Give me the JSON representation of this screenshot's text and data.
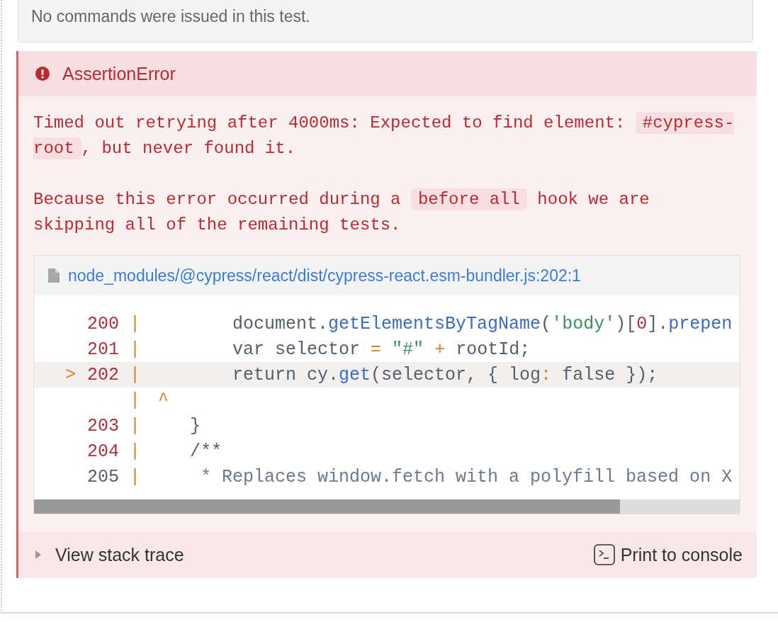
{
  "commands_notice": "No commands were issued in this test.",
  "error": {
    "title": "AssertionError",
    "messages": [
      [
        {
          "text": "Timed out retrying after 4000ms: Expected to find element: ",
          "code": false
        },
        {
          "text": "#cypress-root",
          "code": true
        },
        {
          "text": ", but never found it.",
          "code": false
        }
      ],
      [
        {
          "text": "Because this error occurred during a ",
          "code": false
        },
        {
          "text": "before all",
          "code": true
        },
        {
          "text": " hook we are skipping all of the remaining tests.",
          "code": false
        }
      ]
    ],
    "code_frame": {
      "file": "node_modules/@cypress/react/dist/cypress-react.esm-bundler.js:202:1",
      "lines": [
        {
          "gutter": "200 |",
          "highlighted": false,
          "code": "        document.getElementsByTagName('body')[0].prepen"
        },
        {
          "gutter": "201 |",
          "highlighted": false,
          "code": "        var selector = \"#\" + rootId;"
        },
        {
          "gutter": "> 202 |",
          "highlighted": true,
          "code": "        return cy.get(selector, { log: false });"
        },
        {
          "gutter": "|",
          "highlighted": false,
          "code": " ^"
        },
        {
          "gutter": "203 |",
          "highlighted": false,
          "code": "    }"
        },
        {
          "gutter": "204 |",
          "highlighted": false,
          "code": "    /**"
        },
        {
          "gutter": "205 |",
          "highlighted": false,
          "code": "     * Replaces window.fetch with a polyfill based on X"
        }
      ]
    },
    "stack_trace_toggle": {
      "label": "View stack trace",
      "expanded": false
    },
    "print_button": "Print to console"
  }
}
